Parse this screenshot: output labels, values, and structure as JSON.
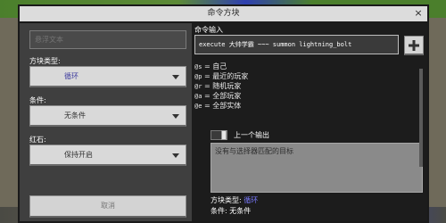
{
  "window": {
    "title": "命令方块",
    "close_label": "×"
  },
  "left": {
    "name_placeholder": "悬浮文本",
    "block_type": {
      "label": "方块类型:",
      "value": "循环"
    },
    "condition": {
      "label": "条件:",
      "value": "无条件"
    },
    "redstone": {
      "label": "红石:",
      "value": "保持开启"
    },
    "cancel_label": "取消"
  },
  "right": {
    "command_label": "命令输入",
    "command_value": "execute 大帅学霸 ~~~ summon lightning_bolt",
    "add_icon": "plus-icon",
    "selectors": [
      {
        "key": "@s",
        "sep": " = ",
        "desc": "自己"
      },
      {
        "key": "@p",
        "sep": " = ",
        "desc": "最近的玩家"
      },
      {
        "key": "@r",
        "sep": " = ",
        "desc": "随机玩家"
      },
      {
        "key": "@a",
        "sep": " = ",
        "desc": "全部玩家"
      },
      {
        "key": "@e",
        "sep": " = ",
        "desc": "全部实体"
      }
    ],
    "previous_output_label": "上一个输出",
    "output_text": "没有与选择器匹配的目标",
    "info": {
      "block_type_label": "方块类型: ",
      "block_type_value": "循环",
      "condition_label": "条件: ",
      "condition_value": "无条件"
    }
  },
  "colors": {
    "accent": "#3d3b9e",
    "panel": "#1c1c1c",
    "titlebar": "#dcdcdc"
  }
}
